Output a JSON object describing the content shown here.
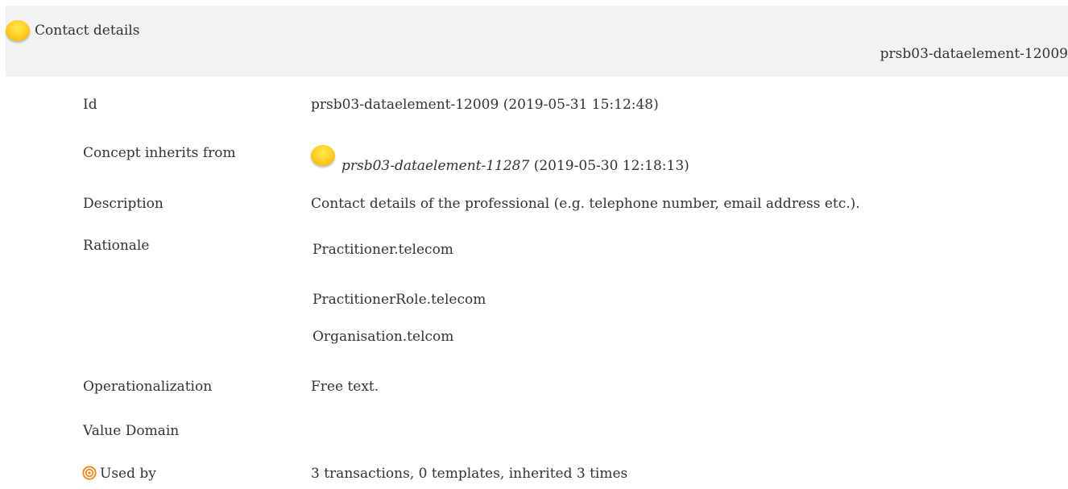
{
  "header": {
    "title": "Contact details",
    "id": "prsb03-dataelement-12009"
  },
  "rows": {
    "id": {
      "label": "Id",
      "value": "prsb03-dataelement-12009 (2019-05-31 15:12:48)"
    },
    "inherits": {
      "label": "Concept inherits from",
      "link": "prsb03-dataelement-11287",
      "date": " (2019-05-30 12:18:13)"
    },
    "description": {
      "label": "Description",
      "value": "Contact details of the professional (e.g. telephone number, email address etc.)."
    },
    "rationale": {
      "label": "Rationale",
      "lines": [
        "Practitioner.telecom",
        "PractitionerRole.telecom",
        "Organisation.telcom"
      ]
    },
    "operationalization": {
      "label": "Operationalization",
      "value": "Free text."
    },
    "value_domain": {
      "label": "Value Domain",
      "value": ""
    },
    "used_by": {
      "label": "Used by",
      "value": "3 transactions, 0 templates, inherited 3 times"
    }
  },
  "icons": {
    "status_dot": "yellow-status-dot-icon",
    "used_by": "target-icon"
  },
  "colors": {
    "header_bg": "#f2f2f2",
    "status_dot": "#ffcc22",
    "used_by_icon": "#f28c28"
  }
}
